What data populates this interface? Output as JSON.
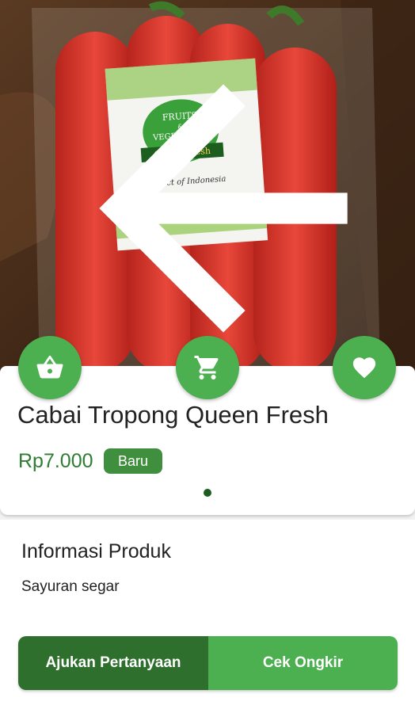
{
  "product": {
    "title": "Cabai Tropong Queen Fresh",
    "price": "Rp7.000",
    "condition_badge": "Baru",
    "image_page_indicator": "1"
  },
  "label_sticker": {
    "line1": "FRUITS",
    "line2": "&",
    "line3": "VEGETABLES",
    "brand": "Queen Fresh",
    "tagline": "Product of Indonesia"
  },
  "info": {
    "heading": "Informasi Produk",
    "description": "Sayuran segar"
  },
  "actions": {
    "ask_label": "Ajukan Pertanyaan",
    "shipping_label": "Cek Ongkir"
  },
  "icons": {
    "back": "arrow-back-icon",
    "share": "share-icon",
    "basket": "basket-icon",
    "cart": "cart-icon",
    "favorite": "heart-icon"
  },
  "colors": {
    "primary_green": "#4caf50",
    "dark_green": "#2e6f2e",
    "price_green": "#2e7d32"
  }
}
